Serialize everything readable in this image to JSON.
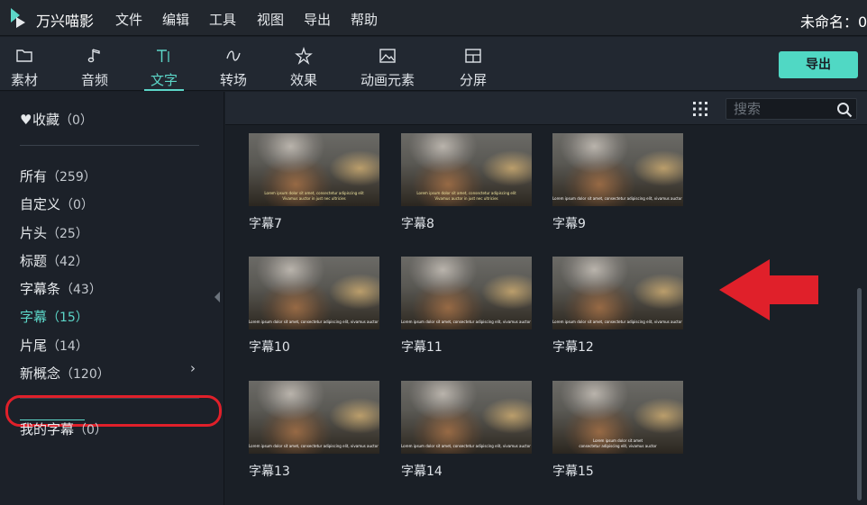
{
  "menubar": {
    "app_name": "万兴喵影",
    "items": [
      "文件",
      "编辑",
      "工具",
      "视图",
      "导出",
      "帮助"
    ],
    "project_title": "未命名：0"
  },
  "toolbar": {
    "tabs": [
      {
        "label": "素材",
        "icon": "folder-icon"
      },
      {
        "label": "音频",
        "icon": "music-note-icon"
      },
      {
        "label": "文字",
        "icon": "text-icon",
        "active": true
      },
      {
        "label": "转场",
        "icon": "transition-icon"
      },
      {
        "label": "效果",
        "icon": "effects-icon"
      },
      {
        "label": "动画元素",
        "icon": "image-icon"
      },
      {
        "label": "分屏",
        "icon": "split-screen-icon"
      }
    ],
    "export_label": "导出"
  },
  "sidebar": {
    "favorites": {
      "label": "收藏",
      "count": "（0）"
    },
    "items": [
      {
        "label": "所有",
        "count": "（259）"
      },
      {
        "label": "自定义",
        "count": "（0）"
      },
      {
        "label": "片头",
        "count": "（25）"
      },
      {
        "label": "标题",
        "count": "（42）"
      },
      {
        "label": "字幕条",
        "count": "（43）"
      },
      {
        "label": "字幕",
        "count": "（15）",
        "active": true
      },
      {
        "label": "片尾",
        "count": "（14）"
      },
      {
        "label": "新概念",
        "count": "（120）"
      }
    ],
    "my_subtitles": {
      "label": "我的字幕",
      "count": "（0）"
    }
  },
  "search": {
    "placeholder": "搜索"
  },
  "cards": [
    {
      "label": "字幕7"
    },
    {
      "label": "字幕8"
    },
    {
      "label": "字幕9"
    },
    {
      "label": "字幕10"
    },
    {
      "label": "字幕11"
    },
    {
      "label": "字幕12"
    },
    {
      "label": "字幕13"
    },
    {
      "label": "字幕14"
    },
    {
      "label": "字幕15"
    }
  ],
  "colors": {
    "accent": "#5cd6c8",
    "export_button": "#50d8c4",
    "annotation_red": "#e0202a"
  }
}
